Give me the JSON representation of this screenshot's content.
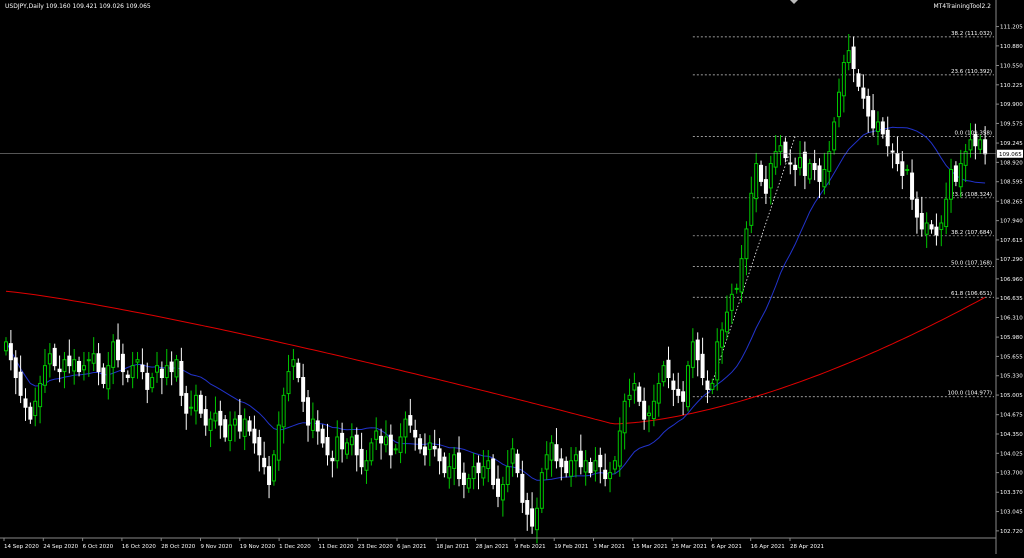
{
  "header": {
    "symbol_info": "USDJPY,Daily  109.160 109.421 109.026 109.065",
    "indicator_name": "MT4TrainingTool2.2"
  },
  "colors": {
    "background": "#000000",
    "bull_candle": "#00c800",
    "bear_candle": "#ffffff",
    "ma_fast": "#2233cc",
    "ma_slow": "#e00000",
    "fib_line": "#cccccc",
    "axis_text": "#ffffff",
    "current_price_tag_bg": "#ffffff",
    "current_price_tag_text": "#000000"
  },
  "chart_data": {
    "type": "candlestick",
    "title": "USDJPY,Daily",
    "ohlc_last": {
      "open": 109.16,
      "high": 109.421,
      "low": 109.026,
      "close": 109.065
    },
    "current_price": "109.065",
    "ylim": [
      102.6,
      111.45
    ],
    "y_ticks": [
      "111.205",
      "110.880",
      "110.550",
      "110.225",
      "109.900",
      "109.575",
      "109.245",
      "108.920",
      "108.595",
      "108.265",
      "107.940",
      "107.615",
      "107.290",
      "106.960",
      "106.635",
      "106.310",
      "105.980",
      "105.655",
      "105.330",
      "105.005",
      "104.675",
      "104.350",
      "104.025",
      "103.700",
      "103.370",
      "103.045",
      "102.720",
      "102.390"
    ],
    "x_ticks": [
      "14 Sep 2020",
      "24 Sep 2020",
      "6 Oct 2020",
      "16 Oct 2020",
      "28 Oct 2020",
      "9 Nov 2020",
      "19 Nov 2020",
      "1 Dec 2020",
      "11 Dec 2020",
      "23 Dec 2020",
      "6 Jan 2021",
      "18 Jan 2021",
      "28 Jan 2021",
      "9 Feb 2021",
      "19 Feb 2021",
      "3 Mar 2021",
      "15 Mar 2021",
      "25 Mar 2021",
      "6 Apr 2021",
      "16 Apr 2021",
      "28 Apr 2021"
    ],
    "fib_levels": [
      {
        "label": "38.2 (111.032)",
        "value": 111.032
      },
      {
        "label": "23.6 (110.392)",
        "value": 110.392
      },
      {
        "label": "0.0 (109.358)",
        "value": 109.358
      },
      {
        "label": "23.6 (108.324)",
        "value": 108.324
      },
      {
        "label": "38.2 (107.684)",
        "value": 107.684
      },
      {
        "label": "50.0 (107.168)",
        "value": 107.168
      },
      {
        "label": "61.8 (106.651)",
        "value": 106.651
      },
      {
        "label": "100.0 (104.977)",
        "value": 104.977
      }
    ],
    "fib_anchor": {
      "from_value": 104.977,
      "to_value": 109.358
    },
    "closes": [
      105.9,
      105.6,
      105.3,
      105.0,
      104.8,
      104.6,
      104.9,
      105.2,
      105.5,
      105.7,
      105.5,
      105.4,
      105.6,
      105.5,
      105.6,
      105.4,
      105.5,
      105.6,
      105.7,
      105.4,
      105.2,
      105.5,
      105.9,
      105.6,
      105.4,
      105.3,
      105.5,
      105.6,
      105.4,
      105.1,
      105.3,
      105.5,
      105.3,
      105.5,
      105.4,
      105.6,
      105.0,
      104.7,
      104.8,
      105.0,
      104.7,
      104.5,
      104.6,
      104.7,
      104.5,
      104.3,
      104.5,
      104.6,
      104.4,
      104.6,
      104.4,
      104.2,
      104.0,
      103.8,
      103.5,
      104.0,
      104.5,
      105.0,
      105.4,
      105.6,
      105.3,
      104.9,
      104.5,
      104.6,
      104.4,
      104.2,
      104.0,
      103.9,
      104.3,
      104.1,
      104.2,
      104.3,
      104.0,
      103.8,
      103.9,
      104.2,
      104.4,
      104.2,
      104.3,
      104.0,
      104.1,
      104.3,
      104.6,
      104.5,
      104.3,
      104.1,
      104.0,
      104.2,
      104.1,
      103.9,
      103.7,
      103.8,
      104.0,
      103.6,
      103.5,
      103.6,
      103.8,
      103.7,
      103.8,
      103.9,
      103.5,
      103.3,
      103.5,
      103.8,
      104.1,
      103.7,
      103.2,
      103.0,
      102.8,
      103.1,
      103.7,
      104.0,
      104.2,
      103.9,
      103.8,
      103.7,
      103.9,
      104.0,
      103.8,
      103.9,
      103.7,
      103.9,
      103.8,
      103.6,
      103.7,
      103.9,
      104.4,
      104.9,
      105.0,
      105.2,
      104.9,
      104.6,
      104.7,
      104.9,
      105.2,
      105.5,
      105.3,
      105.1,
      105.0,
      104.9,
      105.5,
      105.9,
      105.6,
      105.3,
      105.1,
      105.2,
      105.9,
      106.1,
      106.4,
      106.7,
      106.8,
      107.3,
      107.8,
      108.4,
      108.9,
      108.6,
      108.4,
      108.9,
      109.1,
      109.2,
      109.0,
      108.9,
      108.8,
      109.0,
      108.7,
      108.9,
      108.8,
      108.6,
      108.8,
      109.1,
      109.6,
      110.1,
      110.6,
      110.8,
      110.5,
      110.2,
      110.0,
      109.7,
      109.5,
      109.6,
      109.4,
      109.2,
      109.1,
      108.9,
      108.7,
      108.8,
      108.3,
      108.0,
      107.8,
      107.9,
      107.8,
      107.7,
      107.9,
      108.3,
      108.8,
      108.6,
      108.9,
      109.1,
      109.3,
      109.2,
      109.3,
      109.065
    ],
    "ma_fast": {
      "start": 105.7,
      "end": 108.85,
      "peak": 109.55
    },
    "ma_slow": {
      "start": 106.75,
      "end": 106.45,
      "trough": 104.52
    }
  }
}
